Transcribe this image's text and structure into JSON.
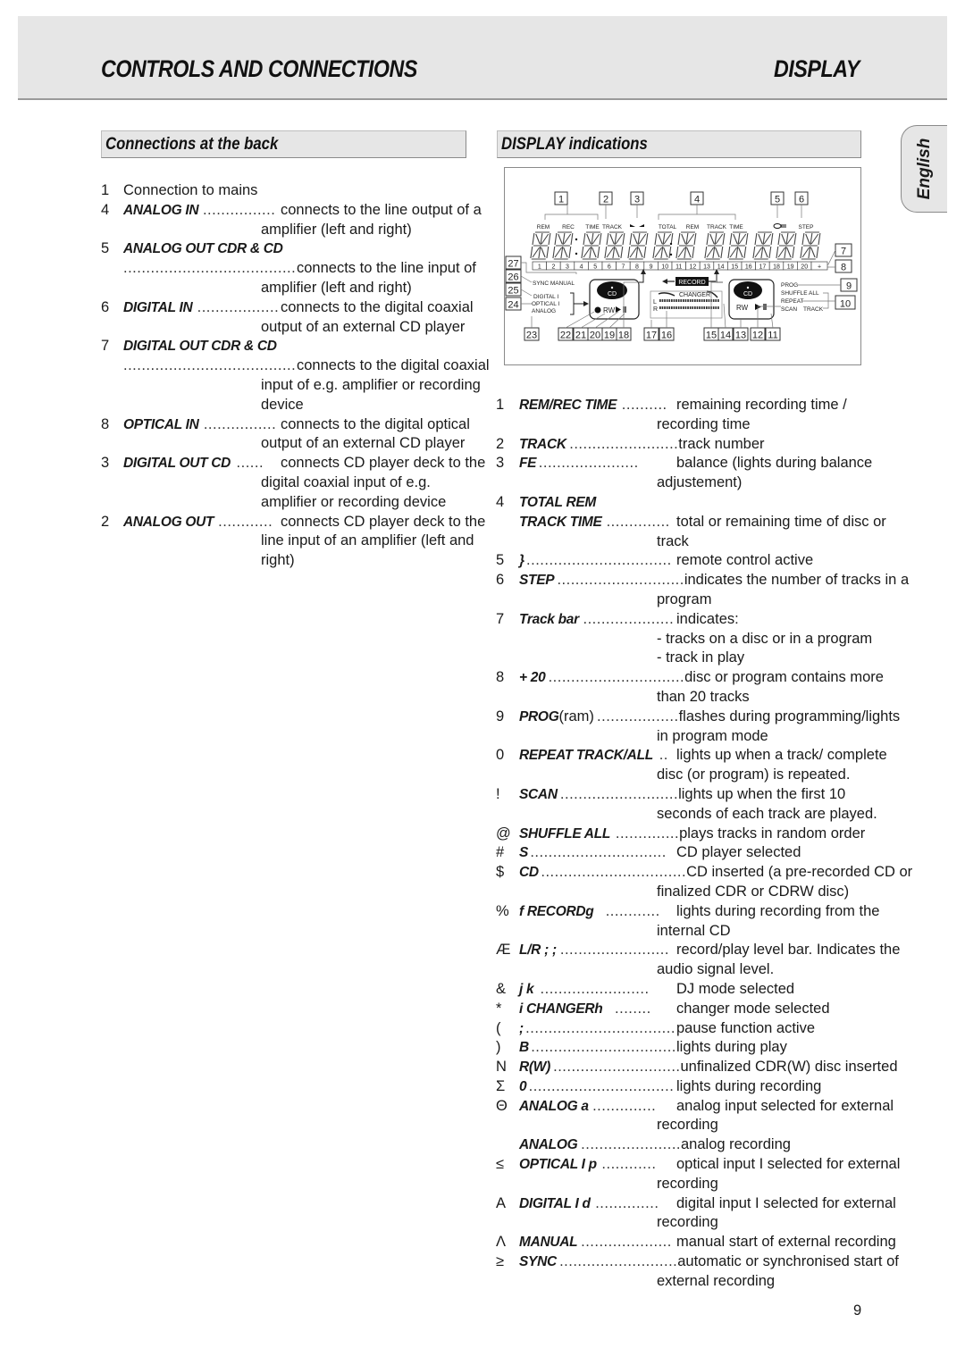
{
  "header": {
    "left_title": "CONTROLS AND CONNECTIONS",
    "right_title": "DISPLAY"
  },
  "language_tab": "English",
  "left_section": {
    "title": "Connections at the back",
    "items": [
      {
        "num": "1",
        "term": "",
        "plain_title": "Connection to mains",
        "dots": "",
        "desc": []
      },
      {
        "num": "4",
        "term": "ANALOG IN",
        "dots": "................",
        "desc": [
          "connects to the line output of a",
          "amplifier (left and right)"
        ]
      },
      {
        "num": "5",
        "term": "ANALOG OUT CDR & CD",
        "dots": "......................................",
        "desc": [
          "connects to the line input of",
          "amplifier (left and right)"
        ]
      },
      {
        "num": "6",
        "term": "DIGITAL IN",
        "dots": "..................",
        "desc": [
          "connects to the digital coaxial",
          "output of an external CD player"
        ]
      },
      {
        "num": "7",
        "term": "DIGITAL OUT CDR & CD",
        "dots": "......................................",
        "desc": [
          "connects to the digital coaxial",
          "input of e.g. amplifier or recording",
          "device"
        ]
      },
      {
        "num": "8",
        "term": "OPTICAL IN",
        "dots": "................",
        "desc": [
          "connects to the digital optical",
          "output of an external CD player"
        ]
      },
      {
        "num": "3",
        "term": "DIGITAL OUT CD",
        "dots": "......",
        "desc": [
          "connects CD player deck to the",
          "digital coaxial input of e.g.",
          "amplifier or recording device"
        ]
      },
      {
        "num": "2",
        "term": "ANALOG OUT",
        "dots": "............",
        "desc": [
          "connects CD player deck to the",
          "line input of an amplifier (left and",
          "right)"
        ]
      }
    ]
  },
  "right_section": {
    "title": "DISPLAY indications",
    "diagram": {
      "top_labels": [
        "REM",
        "REC",
        "TIME",
        "TRACK",
        "TOTAL",
        "REM",
        "TRACK",
        "TIME",
        "STEP"
      ],
      "callouts_top": [
        "1",
        "2",
        "3",
        "4",
        "5",
        "6"
      ],
      "callouts_right": [
        "7",
        "8",
        "9",
        "10"
      ],
      "callouts_left": [
        "27",
        "26",
        "25",
        "24"
      ],
      "callouts_bottom": [
        "23",
        "22",
        "21",
        "20",
        "19",
        "18",
        "17",
        "16",
        "15",
        "14",
        "13",
        "12",
        "11"
      ],
      "track_bar": [
        "1",
        "2",
        "3",
        "4",
        "5",
        "6",
        "7",
        "8",
        "9",
        "10",
        "11",
        "12",
        "13",
        "14",
        "15",
        "16",
        "17",
        "18",
        "19",
        "20",
        "+"
      ],
      "left_labels": [
        "SYNC MANUAL",
        "DIGITAL I",
        "OPTICAL I",
        "ANALOG"
      ],
      "cd_label": "CD",
      "rw_label": "RW",
      "record_label": "RECORD",
      "changer_label": "CHANGER",
      "level_l": "L",
      "level_r": "R",
      "right_labels": [
        "PROG",
        "SHUFFLE",
        "ALL",
        "REPEAT",
        "SCAN",
        "TRACK"
      ]
    },
    "items": [
      {
        "num": "1",
        "term": "REM/REC TIME",
        "dots": "..........",
        "desc": [
          "remaining recording time /",
          "recording time"
        ]
      },
      {
        "num": "2",
        "term": "TRACK",
        "dots": "........................",
        "desc": [
          "track number"
        ]
      },
      {
        "num": "3",
        "term": "FE",
        "dots": "......................",
        "desc": [
          "balance (lights during balance",
          "adjustement)"
        ]
      },
      {
        "num": "4",
        "term": "TOTAL REM",
        "dots": "",
        "desc": [
          ""
        ]
      },
      {
        "num": "",
        "term": "TRACK TIME",
        "dots": "..............",
        "desc": [
          "total or remaining time of disc or",
          "track"
        ]
      },
      {
        "num": "5",
        "term": "}",
        "dots": "................................",
        "desc": [
          "remote control active"
        ]
      },
      {
        "num": "6",
        "term": "STEP",
        "dots": "............................",
        "desc": [
          "indicates the number of tracks in a",
          "program"
        ]
      },
      {
        "num": "7",
        "term": "Track bar",
        "dots": "....................",
        "desc": [
          "indicates:",
          "- tracks on a disc or in a program",
          "- track in play"
        ]
      },
      {
        "num": "8",
        "term": "+ 20",
        "dots": "..............................",
        "desc": [
          "disc or program contains more",
          "than 20 tracks"
        ]
      },
      {
        "num": "9",
        "term": "PROG",
        "term_plain": "(ram)",
        "dots": "..................",
        "desc": [
          "flashes during programming/lights",
          "in program mode"
        ]
      },
      {
        "num": "0",
        "term": "REPEAT TRACK/ALL",
        "dots": "..",
        "desc": [
          "lights up when a track/ complete",
          "disc (or program) is repeated."
        ]
      },
      {
        "num": "!",
        "term": "SCAN",
        "dots": "..........................",
        "desc": [
          "lights up when the first 10",
          "seconds of each track are played."
        ]
      },
      {
        "num": "@",
        "term": "SHUFFLE ALL",
        "dots": "..............",
        "desc": [
          "plays tracks in random order"
        ]
      },
      {
        "num": "#",
        "term": "S",
        "dots": "..............................",
        "desc": [
          "CD player selected"
        ]
      },
      {
        "num": "$",
        "term": "CD",
        "dots": "................................",
        "desc": [
          "CD inserted  (a pre-recorded CD or",
          "finalized CDR or CDRW disc)"
        ]
      },
      {
        "num": "%",
        "term": "f   RECORDg",
        "dots": "............",
        "desc": [
          "lights during recording from the",
          "internal CD"
        ]
      },
      {
        "num": "Æ",
        "term": "L/R ; ;",
        "dots": "........................",
        "desc": [
          "record/play level bar. Indicates the",
          "audio signal level."
        ]
      },
      {
        "num": "&",
        "term": "j  k",
        "dots": "........................",
        "desc": [
          "DJ mode selected"
        ]
      },
      {
        "num": "*",
        "term": "i   CHANGERh",
        "dots": "........",
        "desc": [
          "changer mode selected"
        ]
      },
      {
        "num": "(",
        "term": ";",
        "dots": ".................................",
        "desc": [
          "pause function active"
        ]
      },
      {
        "num": ")",
        "term": "B",
        "dots": "................................",
        "desc": [
          "lights during play"
        ]
      },
      {
        "num": "N",
        "term": "R(W)",
        "dots": "............................",
        "desc": [
          "unfinalized CDR(W) disc inserted"
        ]
      },
      {
        "num": "Σ",
        "term": "0",
        "dots": "................................",
        "desc": [
          "lights during recording"
        ]
      },
      {
        "num": "Θ",
        "term": "ANALOG a",
        "dots": "..............",
        "desc": [
          "analog input selected for external",
          "recording"
        ]
      },
      {
        "num": "",
        "term": "ANALOG",
        "dots": "......................",
        "desc": [
          "analog recording"
        ]
      },
      {
        "num": "≤",
        "term": "OPTICAL I p",
        "dots": "............",
        "desc": [
          "optical input I selected for external",
          "recording"
        ]
      },
      {
        "num": "A",
        "term": "DIGITAL I d",
        "dots": "..............",
        "desc": [
          "digital input I selected for external",
          "recording"
        ]
      },
      {
        "num": "Λ",
        "term": "MANUAL",
        "dots": "....................",
        "desc": [
          "manual start of external recording"
        ]
      },
      {
        "num": "≥",
        "term": "SYNC",
        "dots": "..........................",
        "desc": [
          "automatic or synchronised start of",
          "external recording"
        ]
      }
    ]
  },
  "page_number": "9"
}
